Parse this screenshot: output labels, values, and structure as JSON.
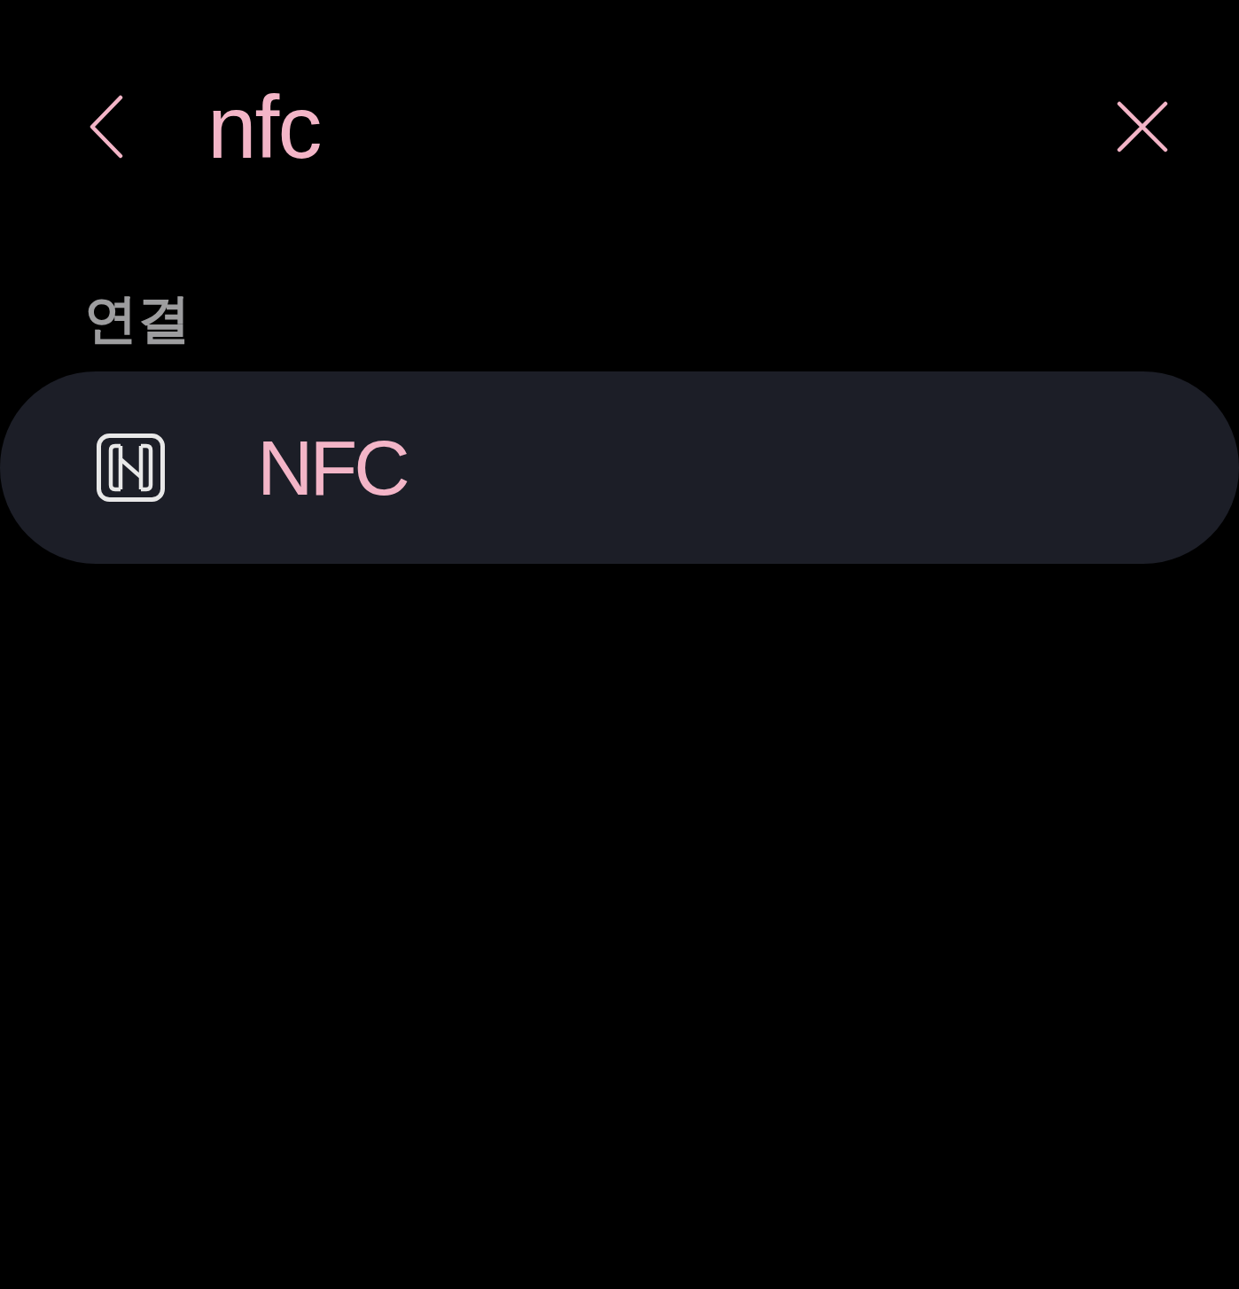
{
  "search": {
    "value": "nfc"
  },
  "sections": [
    {
      "title": "연결",
      "items": [
        {
          "label": "NFC"
        }
      ]
    }
  ]
}
